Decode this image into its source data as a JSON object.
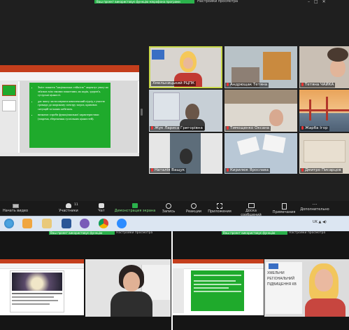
{
  "top_window": {
    "banner_text": "Ваш проект використовує функцію мікрофона програми",
    "title": "Настройки просмотра",
    "shared_slide": {
      "bullets": [
        "Зміст поняття \"національна стійкість\" акцентує увагу на зв'язках між такими поняттями, як надія, здоров'я, сусідські цінності.",
        "дає змогу застосовувати комплексний підхід з участю громади до широкому спектру загроз, кризових ситуацій та інших небезпек.",
        "визначає спроби функціональної характеристики (зокрема, збереження суспільних цінностей)."
      ]
    },
    "participants": [
      {
        "name": "Хмельницький РЦПК",
        "active": true
      },
      {
        "name": "Андрющак Тетяна"
      },
      {
        "name": "Тетяна ЧАЙКА"
      },
      {
        "name": "Жук Лариса Григорівна"
      },
      {
        "name": "Тимощенко Оксана"
      },
      {
        "name": "Жарба Ігор"
      },
      {
        "name": "Наталія Ващук"
      },
      {
        "name": "Кирилюк Ярослава"
      },
      {
        "name": "Дмитро Писарцов"
      }
    ],
    "toolbar": {
      "start_video": "Начать видео",
      "participants": "Участники",
      "participants_count": "11",
      "chat": "Чат",
      "share_screen": "Демонстрация экрана",
      "record": "Запись",
      "reactions": "Реакции",
      "apps": "Приложения",
      "whiteboard": "Доска сообщений",
      "notes": "Примечания",
      "more": "Дополнительно"
    }
  },
  "taskbar": {
    "tray_lang": "UK",
    "tray_icons": "▲ ◀)"
  },
  "bottom_left": {
    "banner_text": "Ваш проект використовує функцію",
    "title": "Настройки просмотра"
  },
  "bottom_right": {
    "banner_text": "Ваш проект використовує функцію",
    "title": "Настройки просмотра",
    "sign_lines": [
      "ХМЕЛЬНИ",
      "РЕГІОНАЛЬНИЙ",
      "ПІДВИЩЕННЯ КВ"
    ]
  },
  "colors": {
    "active_tile_border": "#c8d84a",
    "share_green": "#2bb24c",
    "ppt_red": "#c43e1c"
  }
}
